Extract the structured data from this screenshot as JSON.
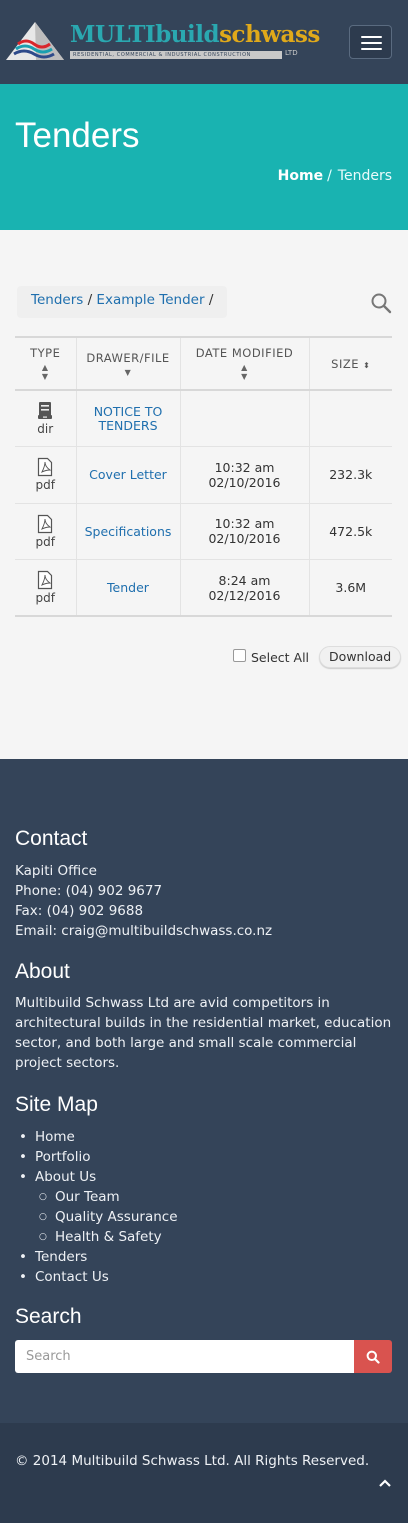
{
  "header": {
    "logo_word_1": "MULTIbuild",
    "logo_word_2": "schwass",
    "logo_tagline": "RESIDENTIAL, COMMERCIAL & INDUSTRIAL CONSTRUCTION",
    "logo_suffix": "LTD",
    "menu_icon": "hamburger-icon"
  },
  "banner": {
    "title": "Tenders",
    "breadcrumb_home": "Home",
    "breadcrumb_separator": "/",
    "breadcrumb_current": "Tenders"
  },
  "file_browser": {
    "path": {
      "root": "Tenders",
      "sep1": " / ",
      "folder": "Example Tender",
      "sep2": " /"
    },
    "columns": {
      "type": "TYPE",
      "name": "DRAWER/FILE",
      "modified": "DATE MODIFIED",
      "size": "SIZE"
    },
    "rows": [
      {
        "icon": "drawer-icon",
        "type": "dir",
        "name": "NOTICE TO TENDERS",
        "time": "",
        "date": "",
        "size": ""
      },
      {
        "icon": "pdf-icon",
        "type": "pdf",
        "name": "Cover Letter",
        "time": "10:32 am",
        "date": "02/10/2016",
        "size": "232.3k"
      },
      {
        "icon": "pdf-icon",
        "type": "pdf",
        "name": "Specifications",
        "time": "10:32 am",
        "date": "02/10/2016",
        "size": "472.5k"
      },
      {
        "icon": "pdf-icon",
        "type": "pdf",
        "name": "Tender",
        "time": "8:24 am",
        "date": "02/12/2016",
        "size": "3.6M"
      }
    ],
    "select_all_label": "Select All",
    "download_label": "Download"
  },
  "footer": {
    "contact_heading": "Contact",
    "office": "Kapiti Office",
    "phone": "Phone: (04) 902 9677",
    "fax": "Fax: (04) 902 9688",
    "email": "Email: craig@multibuildschwass.co.nz",
    "about_heading": "About",
    "about_text": "Multibuild Schwass Ltd are avid competitors in architectural builds in the residential market, education sector, and both large and small scale commercial project sectors.",
    "sitemap_heading": "Site Map",
    "sitemap": {
      "home": "Home",
      "portfolio": "Portfolio",
      "about": "About Us",
      "team": "Our Team",
      "quality": "Quality Assurance",
      "health": "Health & Safety",
      "tenders": "Tenders",
      "contact": "Contact Us"
    },
    "search_heading": "Search",
    "search_placeholder": "Search",
    "copyright": "© 2014 Multibuild Schwass Ltd. All Rights Reserved."
  },
  "colors": {
    "navy": "#344459",
    "teal": "#19b3b1",
    "link": "#1f6fae",
    "search_button": "#d9534f"
  }
}
